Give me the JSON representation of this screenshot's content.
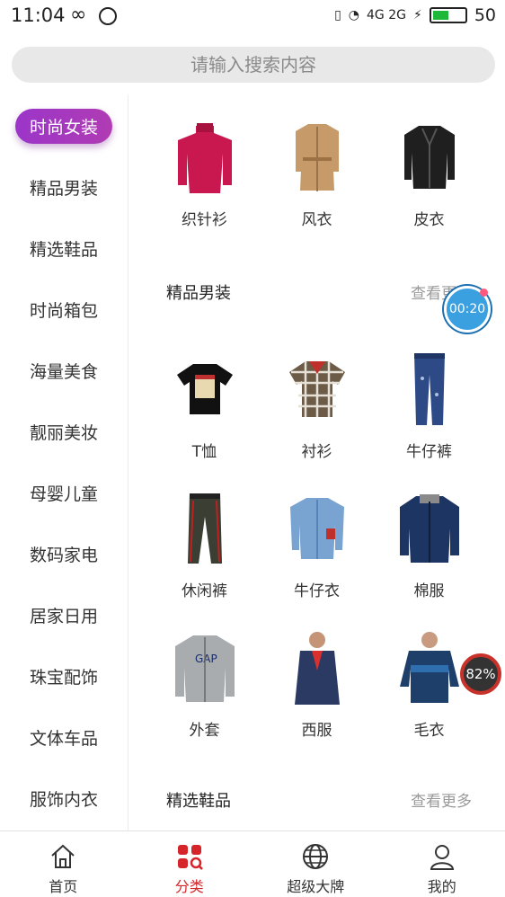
{
  "status": {
    "time": "11:04",
    "battery": "50",
    "battery_level": 0.5,
    "signal": "4G 2G"
  },
  "search": {
    "placeholder": "请输入搜索内容"
  },
  "sidebar": {
    "items": [
      {
        "label": "时尚女装",
        "active": true
      },
      {
        "label": "精品男装"
      },
      {
        "label": "精选鞋品"
      },
      {
        "label": "时尚箱包"
      },
      {
        "label": "海量美食"
      },
      {
        "label": "靓丽美妆"
      },
      {
        "label": "母婴儿童"
      },
      {
        "label": "数码家电"
      },
      {
        "label": "居家日用"
      },
      {
        "label": "珠宝配饰"
      },
      {
        "label": "文体车品"
      },
      {
        "label": "服饰内衣"
      }
    ]
  },
  "women": {
    "products": [
      {
        "label": "织针衫",
        "icon": "knit-sweater-icon",
        "color": "#c8184f"
      },
      {
        "label": "风衣",
        "icon": "trench-coat-icon",
        "color": "#c79a6a"
      },
      {
        "label": "皮衣",
        "icon": "leather-jacket-icon",
        "color": "#1f1f1f"
      }
    ]
  },
  "men": {
    "title": "精品男装",
    "more": "查看更多",
    "products": [
      {
        "label": "T恤",
        "icon": "tshirt-icon",
        "color": "#111111"
      },
      {
        "label": "衬衫",
        "icon": "shirt-icon",
        "color": "#6b5b47"
      },
      {
        "label": "牛仔裤",
        "icon": "jeans-icon",
        "color": "#2d4a86"
      },
      {
        "label": "休闲裤",
        "icon": "pants-icon",
        "color": "#3b3f33"
      },
      {
        "label": "牛仔衣",
        "icon": "denim-jacket-icon",
        "color": "#79a3d1"
      },
      {
        "label": "棉服",
        "icon": "padded-jacket-icon",
        "color": "#1d3563"
      },
      {
        "label": "外套",
        "icon": "jacket-icon",
        "color": "#a9acaf"
      },
      {
        "label": "西服",
        "icon": "suit-icon",
        "color": "#2b3a62"
      },
      {
        "label": "毛衣",
        "icon": "sweater-icon",
        "color": "#1d3f6a"
      }
    ]
  },
  "shoes": {
    "title": "精选鞋品",
    "more": "查看更多"
  },
  "floating": {
    "timer": "00:20",
    "percent": "82%"
  },
  "tabbar": {
    "tabs": [
      {
        "label": "首页",
        "icon": "home-icon"
      },
      {
        "label": "分类",
        "icon": "category-icon",
        "active": true
      },
      {
        "label": "超级大牌",
        "icon": "globe-icon"
      },
      {
        "label": "我的",
        "icon": "user-icon"
      }
    ]
  },
  "colors": {
    "accent": "#d5242a",
    "active_pill": "#9b35c9"
  }
}
